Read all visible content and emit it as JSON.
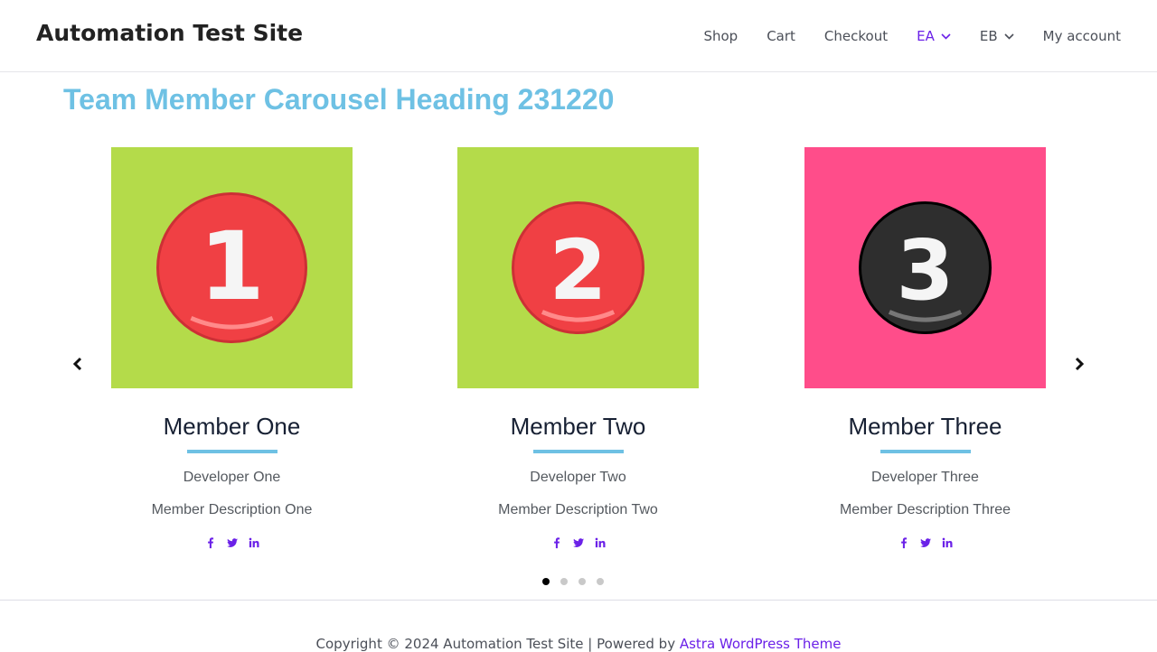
{
  "header": {
    "site_title": "Automation Test Site",
    "nav": [
      {
        "label": "Shop",
        "has_dropdown": false,
        "active": false
      },
      {
        "label": "Cart",
        "has_dropdown": false,
        "active": false
      },
      {
        "label": "Checkout",
        "has_dropdown": false,
        "active": false
      },
      {
        "label": "EA",
        "has_dropdown": true,
        "active": true
      },
      {
        "label": "EB",
        "has_dropdown": true,
        "active": false
      },
      {
        "label": "My account",
        "has_dropdown": false,
        "active": false
      }
    ]
  },
  "main": {
    "heading": "Team Member Carousel Heading 231220",
    "carousel": {
      "members": [
        {
          "number": "1",
          "name": "Member One",
          "role": "Developer One",
          "description": "Member Description One",
          "bg_color": "#b4db4a",
          "badge_color": "#f04044",
          "digit_color": "#f5f5f5"
        },
        {
          "number": "2",
          "name": "Member Two",
          "role": "Developer Two",
          "description": "Member Description Two",
          "bg_color": "#b4db4a",
          "badge_color": "#f04044",
          "digit_color": "#f5f5f5"
        },
        {
          "number": "3",
          "name": "Member Three",
          "role": "Developer Three",
          "description": "Member Description Three",
          "bg_color": "#ff4d8a",
          "badge_color": "#2e2e2e",
          "digit_color": "#f5f5f5"
        }
      ],
      "socials": [
        "facebook-icon",
        "twitter-icon",
        "linkedin-icon"
      ],
      "pagination": {
        "total": 4,
        "active_index": 0
      },
      "colors": {
        "accent_divider": "#6ec1e4",
        "social": "#6b21e8",
        "dot_active": "#000000",
        "dot_inactive": "#c9c9c9"
      }
    }
  },
  "footer": {
    "copyright_text": "Copyright © 2024 Automation Test Site | Powered by ",
    "link_text": "Astra WordPress Theme"
  }
}
